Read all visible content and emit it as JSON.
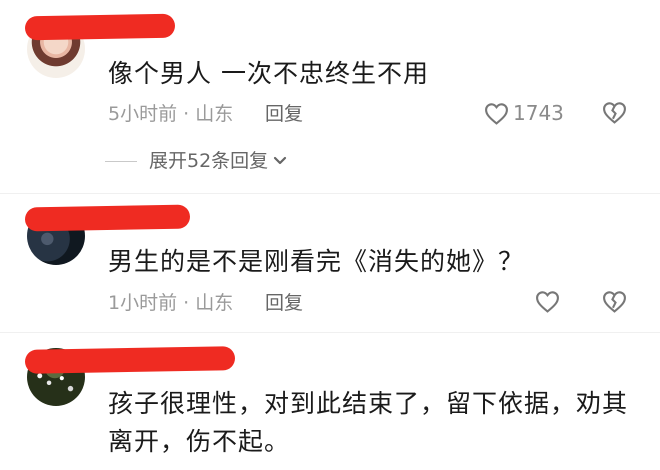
{
  "comments": [
    {
      "text": "像个男人  一次不忠终生不用",
      "time_location": "5小时前 · 山东",
      "reply_label": "回复",
      "likes": "1743",
      "expand_label": "展开52条回复"
    },
    {
      "text": "男生的是不是刚看完《消失的她》？",
      "time_location": "1小时前 · 山东",
      "reply_label": "回复"
    },
    {
      "text": "孩子很理性，对到此结束了，留下依据，劝其离开，伤不起。"
    }
  ],
  "icons": {
    "like": "heart-outline-icon",
    "dislike": "broken-heart-icon",
    "expand": "chevron-down-icon"
  },
  "colors": {
    "text": "#1a1a1a",
    "meta": "#9a9a9a",
    "redaction": "#ef2b22"
  }
}
